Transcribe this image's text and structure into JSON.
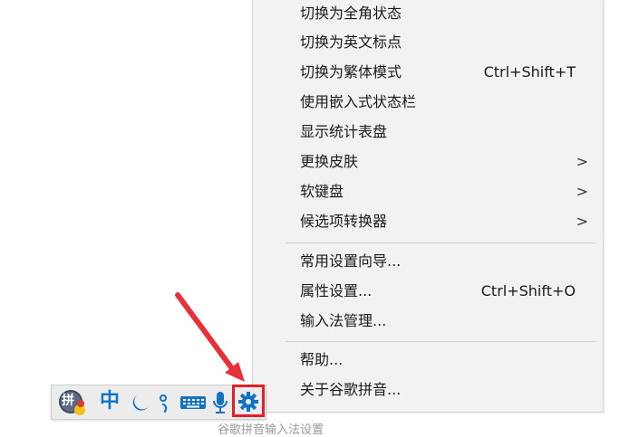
{
  "menu": {
    "items": [
      {
        "label": "切换为全角状态",
        "shortcut": "",
        "submenu": false
      },
      {
        "label": "切换为英文标点",
        "shortcut": "",
        "submenu": false
      },
      {
        "label": "切换为繁体模式",
        "shortcut": "Ctrl+Shift+T",
        "submenu": false
      },
      {
        "label": "使用嵌入式状态栏",
        "shortcut": "",
        "submenu": false
      },
      {
        "label": "显示统计表盘",
        "shortcut": "",
        "submenu": false
      },
      {
        "label": "更换皮肤",
        "shortcut": "",
        "submenu": true
      },
      {
        "label": "软键盘",
        "shortcut": "",
        "submenu": true
      },
      {
        "label": "候选项转换器",
        "shortcut": "",
        "submenu": true
      },
      {
        "label": "常用设置向导...",
        "shortcut": "",
        "submenu": false
      },
      {
        "label": "属性设置...",
        "shortcut": "Ctrl+Shift+O",
        "submenu": false
      },
      {
        "label": "输入法管理...",
        "shortcut": "",
        "submenu": false
      },
      {
        "label": "帮助...",
        "shortcut": "",
        "submenu": false
      },
      {
        "label": "关于谷歌拼音...",
        "shortcut": "",
        "submenu": false
      }
    ],
    "submenu_arrow": ">"
  },
  "toolbar": {
    "logo_char": "拼",
    "mode_label": "中",
    "icons": [
      "logo-icon",
      "chinese-mode-label",
      "half-moon-icon",
      "punctuation-icon",
      "keyboard-icon",
      "microphone-icon",
      "settings-gear-icon"
    ]
  },
  "colors": {
    "menu_bg": "#f2f2f2",
    "toolbar_blue": "#1273c5",
    "highlight_red": "#e32028",
    "arrow_red": "#e8303a"
  },
  "caption": "谷歌拼音输入法设置"
}
